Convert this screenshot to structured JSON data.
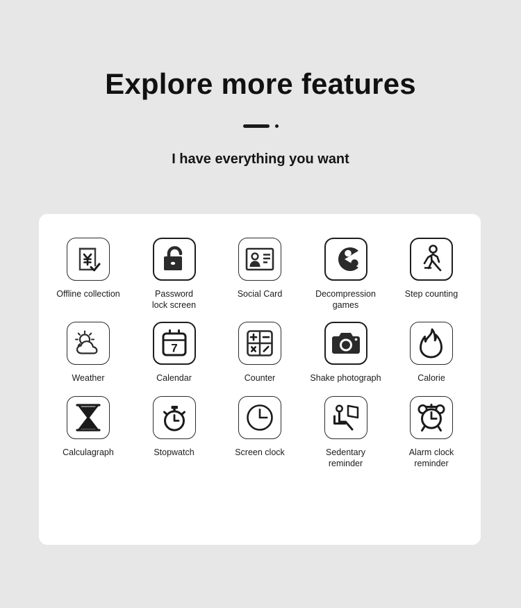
{
  "header": {
    "title": "Explore more features",
    "subtitle": "I have everything you want",
    "divider": {
      "bar": "",
      "dot": ""
    }
  },
  "colors": {
    "background": "#e7e7e7",
    "card": "#ffffff",
    "ink": "#1b1b1b",
    "icon_stroke": "#1e1e1e"
  },
  "features": {
    "rows": [
      [
        {
          "label": "Offline collection",
          "icon": "document-yen-check-icon"
        },
        {
          "label": "Password\nlock screen",
          "icon": "padlock-open-icon"
        },
        {
          "label": "Social Card",
          "icon": "id-card-icon"
        },
        {
          "label": "Decompression\ngames",
          "icon": "pacman-icon"
        },
        {
          "label": "Step counting",
          "icon": "walking-person-icon"
        }
      ],
      [
        {
          "label": "Weather",
          "icon": "sun-cloud-icon"
        },
        {
          "label": "Calendar",
          "icon": "calendar-7-icon"
        },
        {
          "label": "Counter",
          "icon": "calculator-icon"
        },
        {
          "label": "Shake photograph",
          "icon": "camera-icon"
        },
        {
          "label": "Calorie",
          "icon": "flame-icon"
        }
      ],
      [
        {
          "label": "Calculagraph",
          "icon": "hourglass-icon"
        },
        {
          "label": "Stopwatch",
          "icon": "stopwatch-icon"
        },
        {
          "label": "Screen clock",
          "icon": "clock-icon"
        },
        {
          "label": "Sedentary\nreminder",
          "icon": "person-sitting-desk-icon"
        },
        {
          "label": "Alarm clock\nreminder",
          "icon": "alarm-clock-icon"
        }
      ]
    ],
    "calendar_day": "7",
    "currency_symbol": "¥"
  }
}
